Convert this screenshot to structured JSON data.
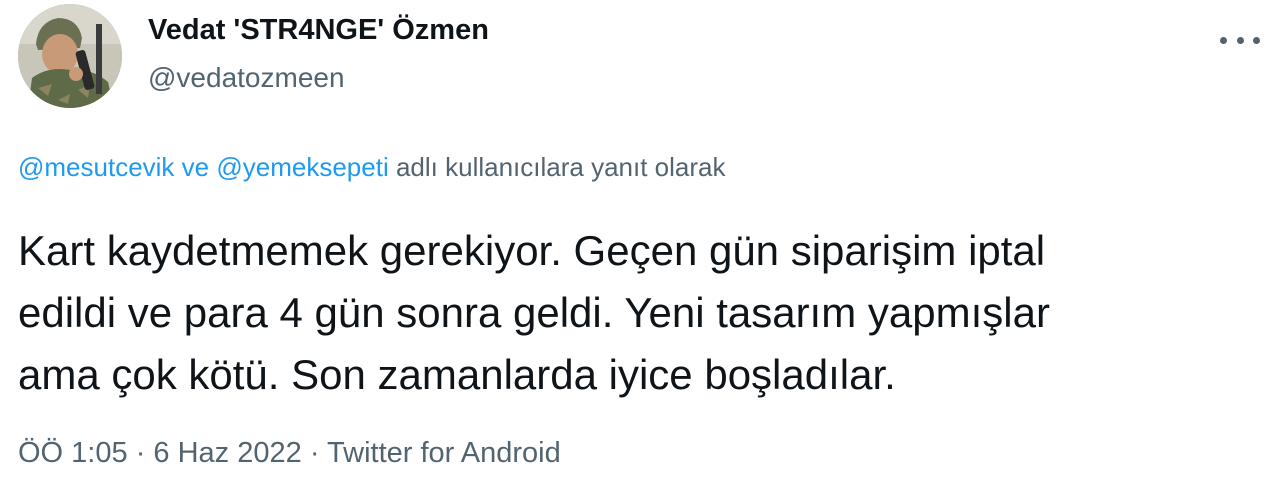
{
  "author": {
    "display_name": "Vedat 'STR4NGE' Özmen",
    "handle": "@vedatozmeen",
    "avatar_icon": "profile-photo"
  },
  "more_icon": "ellipsis-icon",
  "reply_context": {
    "mention1": "@mesutcevik",
    "connector": "ve",
    "mention2": "@yemeksepeti",
    "suffix": "adlı kullanıcılara yanıt olarak"
  },
  "tweet": {
    "line1": "Kart kaydetmemek gerekiyor. Geçen gün siparişim iptal",
    "line2": "edildi ve para 4 gün sonra geldi. Yeni tasarım yapmışlar",
    "line3": "ama çok kötü. Son zamanlarda iyice boşladılar."
  },
  "meta": {
    "time": "ÖÖ 1:05",
    "separator": "·",
    "date": "6 Haz 2022",
    "source": "Twitter for Android"
  },
  "colors": {
    "text": "#0f1419",
    "secondary": "#536471",
    "link": "#1d9bf0"
  }
}
